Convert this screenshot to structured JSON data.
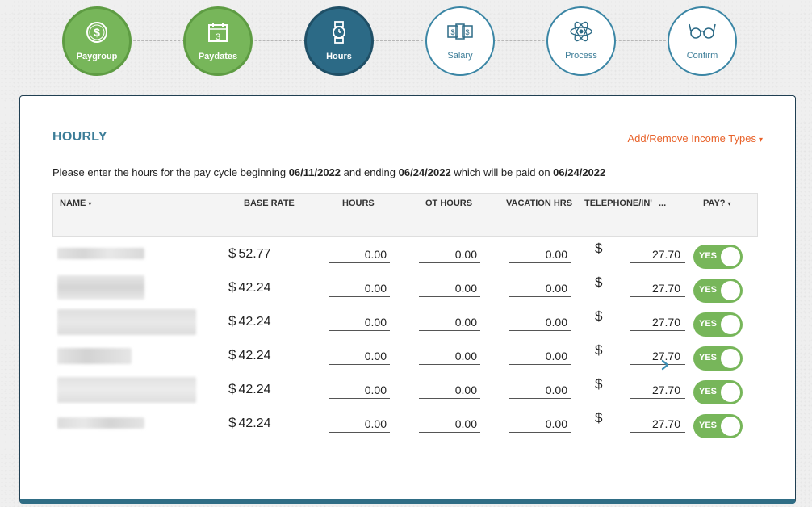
{
  "stepper": {
    "steps": [
      {
        "label": "Paygroup",
        "icon": "dollar-circle-icon",
        "state": "done"
      },
      {
        "label": "Paydates",
        "icon": "calendar-icon",
        "state": "done",
        "icon_text": "3"
      },
      {
        "label": "Hours",
        "icon": "watch-icon",
        "state": "active"
      },
      {
        "label": "Salary",
        "icon": "money-icon",
        "state": "todo"
      },
      {
        "label": "Process",
        "icon": "atom-icon",
        "state": "todo"
      },
      {
        "label": "Confirm",
        "icon": "glasses-icon",
        "state": "todo"
      }
    ]
  },
  "section": {
    "title": "HOURLY",
    "add_remove_label": "Add/Remove Income Types",
    "caret": "▾"
  },
  "instructions": {
    "prefix": "Please enter the hours for the pay cycle beginning ",
    "start_date": "06/11/2022",
    "middle": " and ending ",
    "end_date": "06/24/2022",
    "suffix": " which will be paid on ",
    "pay_date": "06/24/2022"
  },
  "table": {
    "headers": {
      "name": "NAME",
      "base_rate": "BASE RATE",
      "hours": "HOURS",
      "ot_hours": "OT HOURS",
      "vacation": "VACATION HRS",
      "telephone": "TELEPHONE/IN'",
      "more": "...",
      "pay": "PAY?",
      "caret": "▾"
    },
    "currency": "$",
    "rows": [
      {
        "rate": "52.77",
        "hours": "0.00",
        "ot_hours": "0.00",
        "vacation": "0.00",
        "telephone": "27.70",
        "pay": "YES"
      },
      {
        "rate": "42.24",
        "hours": "0.00",
        "ot_hours": "0.00",
        "vacation": "0.00",
        "telephone": "27.70",
        "pay": "YES"
      },
      {
        "rate": "42.24",
        "hours": "0.00",
        "ot_hours": "0.00",
        "vacation": "0.00",
        "telephone": "27.70",
        "pay": "YES"
      },
      {
        "rate": "42.24",
        "hours": "0.00",
        "ot_hours": "0.00",
        "vacation": "0.00",
        "telephone": "27.70",
        "pay": "YES"
      },
      {
        "rate": "42.24",
        "hours": "0.00",
        "ot_hours": "0.00",
        "vacation": "0.00",
        "telephone": "27.70",
        "pay": "YES"
      },
      {
        "rate": "42.24",
        "hours": "0.00",
        "ot_hours": "0.00",
        "vacation": "0.00",
        "telephone": "27.70",
        "pay": "YES"
      }
    ]
  },
  "colors": {
    "done": "#77b65a",
    "active": "#2c6a86",
    "accent_orange": "#e8622a",
    "title_blue": "#3c7d98"
  }
}
